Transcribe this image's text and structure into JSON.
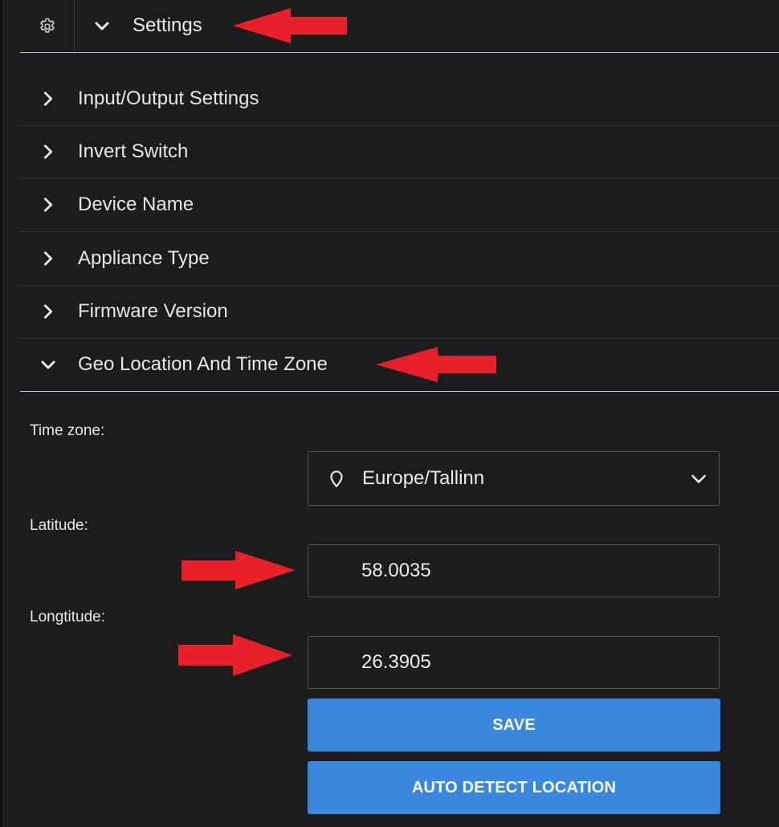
{
  "header": {
    "title": "Settings",
    "settings_icon": "gear-icon",
    "collapse_icon": "chevron-down-icon"
  },
  "sections": [
    {
      "label": "Input/Output Settings",
      "icon": "chevron-right-icon",
      "expanded": false
    },
    {
      "label": "Invert Switch",
      "icon": "chevron-right-icon",
      "expanded": false
    },
    {
      "label": "Device Name",
      "icon": "chevron-right-icon",
      "expanded": false
    },
    {
      "label": "Appliance Type",
      "icon": "chevron-right-icon",
      "expanded": false
    },
    {
      "label": "Firmware Version",
      "icon": "chevron-right-icon",
      "expanded": false
    },
    {
      "label": "Geo Location And Time Zone",
      "icon": "chevron-down-icon",
      "expanded": true
    }
  ],
  "geo": {
    "timezone_label": "Time zone:",
    "timezone_value": "Europe/Tallinn",
    "timezone_icon": "location-pin-icon",
    "latitude_label": "Latitude:",
    "latitude_value": "58.0035",
    "longitude_label": "Longtitude:",
    "longitude_value": "26.3905",
    "save_label": "SAVE",
    "auto_detect_label": "AUTO DETECT LOCATION"
  },
  "colors": {
    "background": "#1c1c1f",
    "accent": "#3a88de",
    "annotation_arrow": "#e8202a"
  }
}
